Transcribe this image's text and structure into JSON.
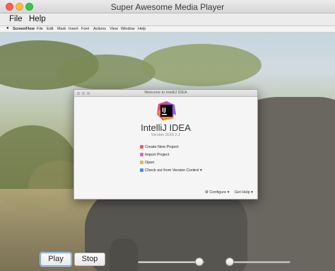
{
  "window": {
    "title": "Super Awesome Media Player"
  },
  "menu": {
    "file": "File",
    "help": "Help"
  },
  "video": {
    "inner_menubar": [
      "ScreenFlow",
      "File",
      "Edit",
      "Mark",
      "Insert",
      "Font",
      "Actions",
      "View",
      "Window",
      "Help"
    ],
    "dialog": {
      "title": "Welcome to IntelliJ IDEA",
      "logo_text": "IJ",
      "app_name": "IntelliJ IDEA",
      "version": "Version 2016.2.2",
      "actions": [
        {
          "label": "Create New Project"
        },
        {
          "label": "Import Project"
        },
        {
          "label": "Open"
        },
        {
          "label": "Check out from Version Control ▾"
        }
      ],
      "footer": {
        "configure": "⚙ Configure ▾",
        "get_help": "Get Help ▾"
      }
    }
  },
  "controls": {
    "play_label": "Play",
    "stop_label": "Stop",
    "progress_value": 0.93,
    "volume_value": 0.05
  },
  "colors": {
    "accent": "#6aa3e0"
  }
}
